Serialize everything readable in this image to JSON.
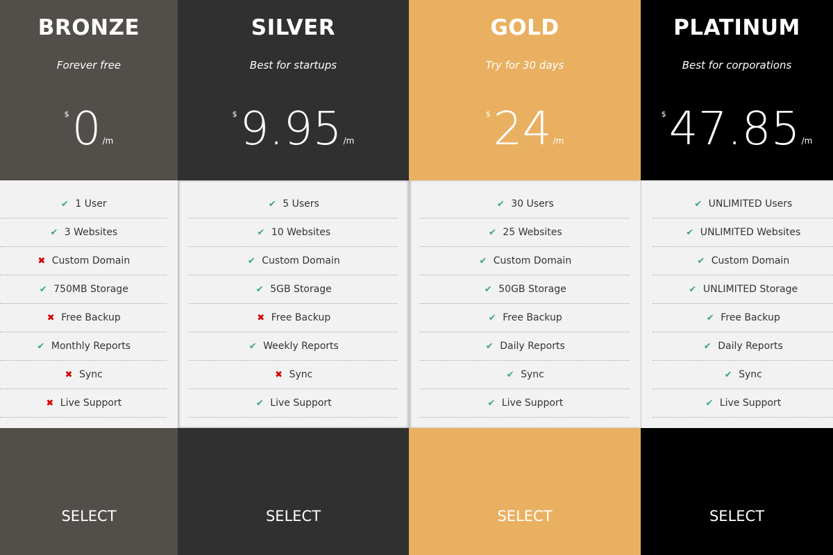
{
  "colors": {
    "bronze": "#524f4a",
    "silver": "#303030",
    "gold": "#e9b061",
    "platinum": "#000000",
    "check": "#3aa876",
    "cross": "#d40000",
    "features_bg": "#f2f2f2"
  },
  "plans": [
    {
      "name": "BRONZE",
      "tagline": "Forever free",
      "currency": "$",
      "amount": "0",
      "period": "/m",
      "button": "SELECT",
      "features": [
        {
          "text": "1 User",
          "included": true
        },
        {
          "text": "3 Websites",
          "included": true
        },
        {
          "text": "Custom Domain",
          "included": false
        },
        {
          "text": "750MB Storage",
          "included": true
        },
        {
          "text": "Free Backup",
          "included": false
        },
        {
          "text": "Monthly Reports",
          "included": true
        },
        {
          "text": "Sync",
          "included": false
        },
        {
          "text": "Live Support",
          "included": false
        }
      ]
    },
    {
      "name": "SILVER",
      "tagline": "Best for startups",
      "currency": "$",
      "amount": "9.95",
      "period": "/m",
      "button": "SELECT",
      "features": [
        {
          "text": "5 Users",
          "included": true
        },
        {
          "text": "10 Websites",
          "included": true
        },
        {
          "text": "Custom Domain",
          "included": true
        },
        {
          "text": "5GB Storage",
          "included": true
        },
        {
          "text": "Free Backup",
          "included": false
        },
        {
          "text": "Weekly Reports",
          "included": true
        },
        {
          "text": "Sync",
          "included": false
        },
        {
          "text": "Live Support",
          "included": true
        }
      ]
    },
    {
      "name": "GOLD",
      "tagline": "Try for 30 days",
      "currency": "$",
      "amount": "24",
      "period": "/m",
      "button": "SELECT",
      "features": [
        {
          "text": "30 Users",
          "included": true
        },
        {
          "text": "25 Websites",
          "included": true
        },
        {
          "text": "Custom Domain",
          "included": true
        },
        {
          "text": "50GB Storage",
          "included": true
        },
        {
          "text": "Free Backup",
          "included": true
        },
        {
          "text": "Daily Reports",
          "included": true
        },
        {
          "text": "Sync",
          "included": true
        },
        {
          "text": "Live Support",
          "included": true
        }
      ]
    },
    {
      "name": "PLATINUM",
      "tagline": "Best for corporations",
      "currency": "$",
      "amount": "47.85",
      "period": "/m",
      "button": "SELECT",
      "features": [
        {
          "text": "UNLIMITED Users",
          "included": true
        },
        {
          "text": "UNLIMITED Websites",
          "included": true
        },
        {
          "text": "Custom Domain",
          "included": true
        },
        {
          "text": "UNLIMITED Storage",
          "included": true
        },
        {
          "text": "Free Backup",
          "included": true
        },
        {
          "text": "Daily Reports",
          "included": true
        },
        {
          "text": "Sync",
          "included": true
        },
        {
          "text": "Live Support",
          "included": true
        }
      ]
    }
  ],
  "icons": {
    "check": "✔",
    "cross": "✖"
  }
}
